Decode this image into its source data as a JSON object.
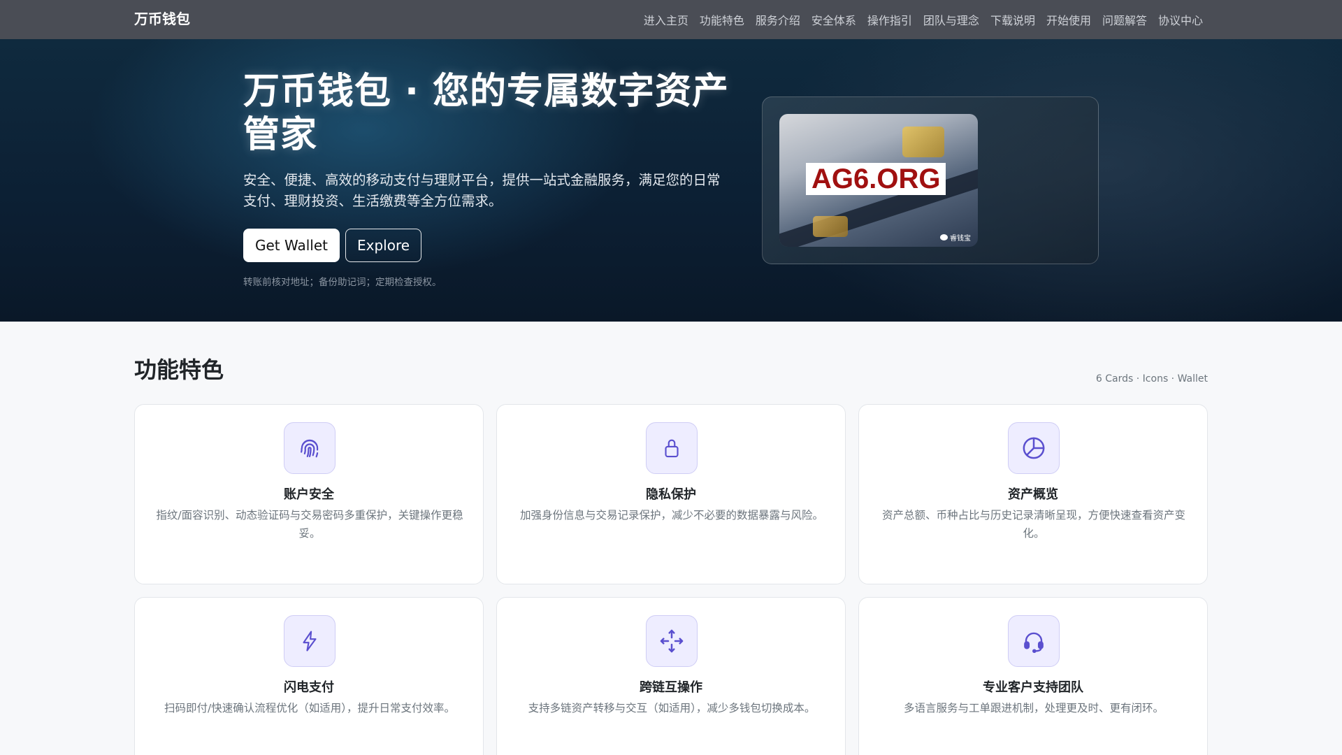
{
  "nav": {
    "brand": "万币钱包",
    "links": [
      "进入主页",
      "功能特色",
      "服务介绍",
      "安全体系",
      "操作指引",
      "团队与理念",
      "下载说明",
      "开始使用",
      "问题解答",
      "协议中心"
    ]
  },
  "hero": {
    "title": "万币钱包 · 您的专属数字资产管家",
    "description": "安全、便捷、高效的移动支付与理财平台，提供一站式金融服务，满足您的日常支付、理财投资、生活缴费等全方位需求。",
    "primary_button": "Get Wallet",
    "secondary_button": "Explore",
    "note": "转账前核对地址；备份助记词；定期检查授权。",
    "image_watermark": "AG6.ORG",
    "image_caption": "睿钱宝"
  },
  "features": {
    "title": "功能特色",
    "meta": "6 Cards · Icons · Wallet",
    "accent_color": "#5a4fcf",
    "cards": [
      {
        "icon": "fingerprint-icon",
        "title": "账户安全",
        "text": "指纹/面容识别、动态验证码与交易密码多重保护，关键操作更稳妥。"
      },
      {
        "icon": "lock-icon",
        "title": "隐私保护",
        "text": "加强身份信息与交易记录保护，减少不必要的数据暴露与风险。"
      },
      {
        "icon": "pie-chart-icon",
        "title": "资产概览",
        "text": "资产总额、币种占比与历史记录清晰呈现，方便快速查看资产变化。"
      },
      {
        "icon": "lightning-icon",
        "title": "闪电支付",
        "text": "扫码即付/快速确认流程优化（如适用），提升日常支付效率。"
      },
      {
        "icon": "arrows-move-icon",
        "title": "跨链互操作",
        "text": "支持多链资产转移与交互（如适用），减少多钱包切换成本。"
      },
      {
        "icon": "headset-icon",
        "title": "专业客户支持团队",
        "text": "多语言服务与工单跟进机制，处理更及时、更有闭环。"
      }
    ]
  }
}
